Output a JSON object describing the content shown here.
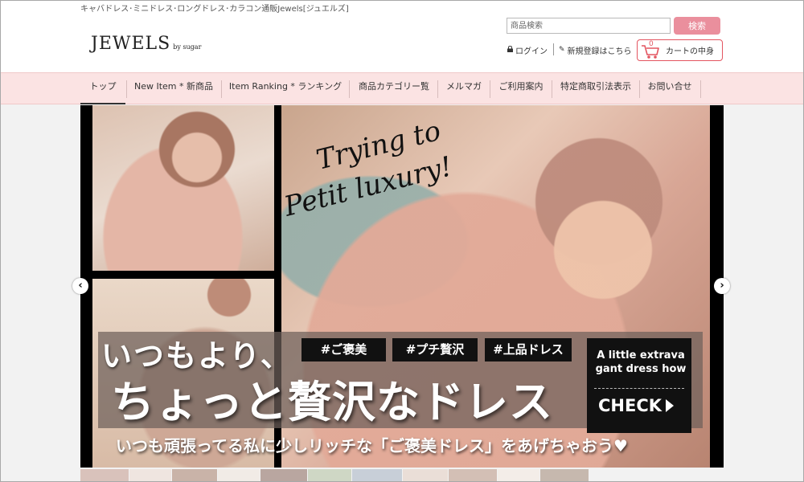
{
  "header": {
    "tagline": "キャバドレス･ミニドレス･ロングドレス･カラコン通販Jewels[ジュエルズ]",
    "logo_main": "JEWELS",
    "logo_sub": "by sugar",
    "search_placeholder": "商品検索",
    "search_button": "検索",
    "login_label": "ログイン",
    "register_label": "新規登録はこちら",
    "cart_count": "0",
    "cart_label": "カートの中身"
  },
  "nav": {
    "items": [
      {
        "label": "トップ"
      },
      {
        "label": "New Item * 新商品"
      },
      {
        "label": "Item Ranking * ランキング"
      },
      {
        "label": "商品カテゴリー覧"
      },
      {
        "label": "メルマガ"
      },
      {
        "label": "ご利用案内"
      },
      {
        "label": "特定商取引法表示"
      },
      {
        "label": "お問い合せ"
      }
    ]
  },
  "banner": {
    "script_line1": "Trying to",
    "script_line2": "Petit luxury!",
    "headline_1": "いつもより、",
    "headline_2": "ちょっと贅沢なドレス",
    "hashtags": [
      "#ご褒美",
      "#プチ贅沢",
      "#上品ドレス"
    ],
    "promo_line1": "A little extrava",
    "promo_line2": "gant dress how",
    "promo_button": "CHECK",
    "caption": "いつも頑張ってる私に少しリッチな「ご褒美ドレス」をあげちゃおう"
  },
  "slider": {
    "prev_glyph": "‹",
    "next_glyph": "›"
  },
  "colors": {
    "accent_pink": "#ea8f9d",
    "cart_red": "#e35560",
    "nav_background": "#fbe3e3"
  }
}
